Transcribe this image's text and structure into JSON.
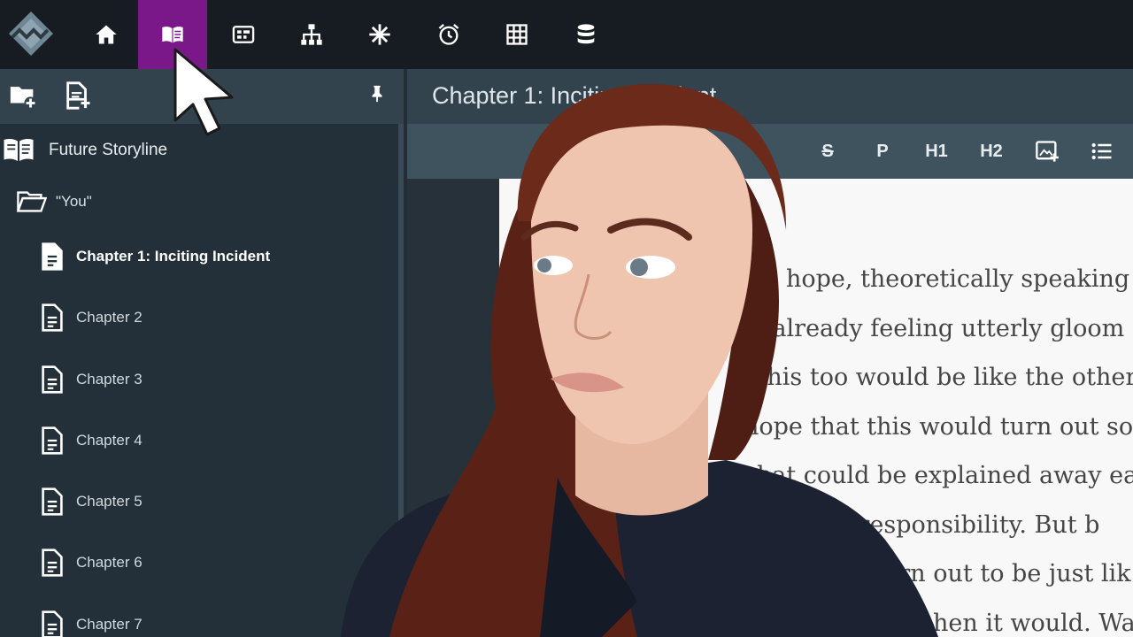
{
  "topnav": {
    "items": [
      {
        "icon": "home-icon"
      },
      {
        "icon": "book-open-icon",
        "active": true
      },
      {
        "icon": "timeline-icon"
      },
      {
        "icon": "hierarchy-icon"
      },
      {
        "icon": "asterisk-icon"
      },
      {
        "icon": "alarm-clock-icon"
      },
      {
        "icon": "grid-icon"
      },
      {
        "icon": "database-icon"
      }
    ],
    "accent": "#7a1889"
  },
  "sidebar": {
    "toolbar": {
      "icons": [
        "new-folder-icon",
        "new-document-icon",
        "pin-icon"
      ]
    },
    "root": {
      "label": "Future Storyline",
      "icon": "book-open-icon"
    },
    "folder": {
      "label": "\"You\"",
      "icon": "folder-open-icon"
    },
    "documents": [
      {
        "label": "Chapter 1: Inciting Incident",
        "current": true
      },
      {
        "label": "Chapter 2"
      },
      {
        "label": "Chapter 3"
      },
      {
        "label": "Chapter 4"
      },
      {
        "label": "Chapter 5"
      },
      {
        "label": "Chapter 6"
      },
      {
        "label": "Chapter 7"
      }
    ]
  },
  "editor": {
    "title": "Chapter 1: Inciting Incident",
    "toolbar": {
      "strikethrough": "S",
      "paragraph": "P",
      "h1": "H1",
      "h2": "H2",
      "image_icon": "insert-image-icon",
      "list_icon": "bullet-list-icon"
    },
    "lines": [
      "hope, theoretically speaking",
      "s already feeling utterly gloom",
      "at this too would be like the others",
      "hope that this would turn out some",
      "that could be explained away eas",
      "else’s responsibility. But b",
      "urn out to be just lik",
      "hen it would. Wal"
    ]
  },
  "overlay": {
    "subject": "presenter-photo",
    "cursor": "mouse-pointer-icon"
  }
}
